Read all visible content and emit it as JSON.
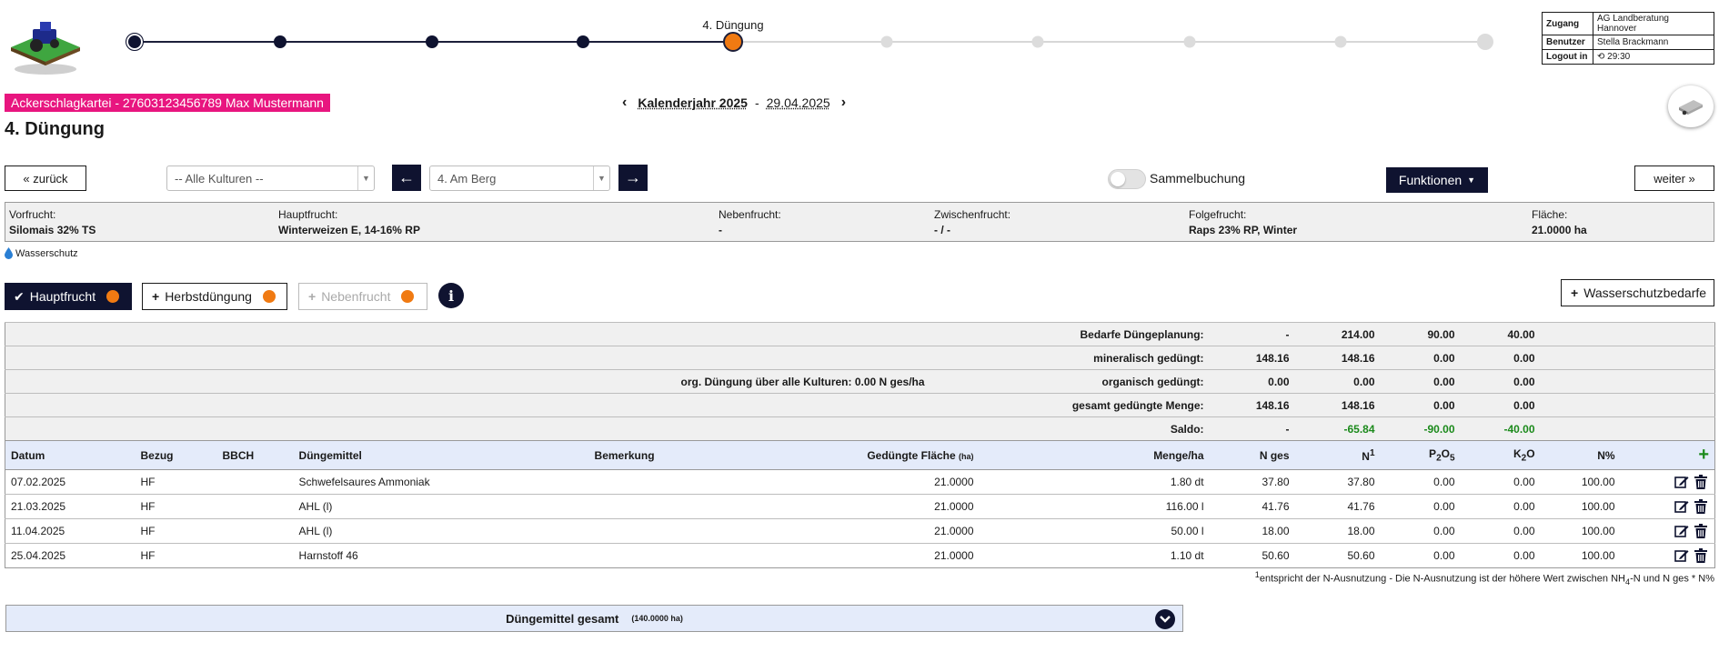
{
  "stepper": {
    "current_label": "4. Düngung",
    "total_steps": 11,
    "current_step": 5
  },
  "user": {
    "zugang_label": "Zugang",
    "zugang_value": "AG Landberatung Hannover",
    "benutzer_label": "Benutzer",
    "benutzer_value": "Stella Brackmann",
    "logout_label": "Logout in",
    "logout_value": "29:30"
  },
  "header": {
    "record": "Ackerschlagkartei - 27603123456789 Max Mustermann",
    "year": "Kalenderjahr 2025",
    "separator": "-",
    "date": "29.04.2025",
    "title": "4. Düngung"
  },
  "toolbar": {
    "back": "« zurück",
    "kulturen": "-- Alle Kulturen --",
    "field": "4. Am Berg",
    "sammelbuchung": "Sammelbuchung",
    "funktionen": "Funktionen",
    "next": "weiter »"
  },
  "crop": {
    "vorfrucht_label": "Vorfrucht:",
    "vorfrucht": "Silomais 32% TS",
    "hauptfrucht_label": "Hauptfrucht:",
    "hauptfrucht": "Winterweizen E, 14-16% RP",
    "nebenfrucht_label": "Nebenfrucht:",
    "nebenfrucht": "-",
    "zwischenfrucht_label": "Zwischenfrucht:",
    "zwischenfrucht": "- / -",
    "folgefrucht_label": "Folgefrucht:",
    "folgefrucht": "Raps 23% RP, Winter",
    "flaeche_label": "Fläche:",
    "flaeche": "21.0000 ha"
  },
  "wasserschutz": "Wasserschutz",
  "tabs": {
    "hauptfrucht": "Hauptfrucht",
    "herbst": "Herbstdüngung",
    "neben": "Nebenfrucht",
    "wasserschutzbedarfe": "Wasserschutzbedarfe"
  },
  "summary": [
    {
      "note": "",
      "label": "Bedarfe Düngeplanung:",
      "v": [
        "-",
        "214.00",
        "90.00",
        "40.00"
      ],
      "green": false
    },
    {
      "note": "",
      "label": "mineralisch gedüngt:",
      "v": [
        "148.16",
        "148.16",
        "0.00",
        "0.00"
      ],
      "green": false
    },
    {
      "note": "org. Düngung über alle Kulturen: 0.00 N ges/ha",
      "label": "organisch gedüngt:",
      "v": [
        "0.00",
        "0.00",
        "0.00",
        "0.00"
      ],
      "green": false
    },
    {
      "note": "",
      "label": "gesamt gedüngte Menge:",
      "v": [
        "148.16",
        "148.16",
        "0.00",
        "0.00"
      ],
      "green": false
    },
    {
      "note": "",
      "label": "Saldo:",
      "v": [
        "-",
        "-65.84",
        "-90.00",
        "-40.00"
      ],
      "green": true
    }
  ],
  "columns": {
    "datum": "Datum",
    "bezug": "Bezug",
    "bbch": "BBCH",
    "duengemittel": "Düngemittel",
    "bemerkung": "Bemerkung",
    "flaeche": "Gedüngte Fläche",
    "flaeche_unit": "(ha)",
    "menge": "Menge/ha",
    "nges": "N ges",
    "n1": "N",
    "n1_sup": "1",
    "p2o5_a": "P",
    "p2o5_s1": "2",
    "p2o5_b": "O",
    "p2o5_s2": "5",
    "k2o_a": "K",
    "k2o_s": "2",
    "k2o_b": "O",
    "npct": "N%"
  },
  "rows": [
    {
      "datum": "07.02.2025",
      "bezug": "HF",
      "bbch": "",
      "duengemittel": "Schwefelsaures Ammoniak",
      "bemerkung": "",
      "flaeche": "21.0000",
      "menge": "1.80 dt",
      "nges": "37.80",
      "n1": "37.80",
      "p2o5": "0.00",
      "k2o": "0.00",
      "npct": "100.00"
    },
    {
      "datum": "21.03.2025",
      "bezug": "HF",
      "bbch": "",
      "duengemittel": "AHL (l)",
      "bemerkung": "",
      "flaeche": "21.0000",
      "menge": "116.00 l",
      "nges": "41.76",
      "n1": "41.76",
      "p2o5": "0.00",
      "k2o": "0.00",
      "npct": "100.00"
    },
    {
      "datum": "11.04.2025",
      "bezug": "HF",
      "bbch": "",
      "duengemittel": "AHL (l)",
      "bemerkung": "",
      "flaeche": "21.0000",
      "menge": "50.00 l",
      "nges": "18.00",
      "n1": "18.00",
      "p2o5": "0.00",
      "k2o": "0.00",
      "npct": "100.00"
    },
    {
      "datum": "25.04.2025",
      "bezug": "HF",
      "bbch": "",
      "duengemittel": "Harnstoff 46",
      "bemerkung": "",
      "flaeche": "21.0000",
      "menge": "1.10 dt",
      "nges": "50.60",
      "n1": "50.60",
      "p2o5": "0.00",
      "k2o": "0.00",
      "npct": "100.00"
    }
  ],
  "footnote": {
    "sup": "1",
    "text_a": "entspricht der N-Ausnutzung - Die N-Ausnutzung ist der höhere Wert zwischen NH",
    "sub": "4",
    "text_b": "-N und N ges * N%"
  },
  "total": {
    "label": "Düngemittel gesamt",
    "area": "(140.0000 ha)"
  },
  "colors": {
    "navy": "#0f1330",
    "pink": "#e8157f",
    "orange": "#f07a12",
    "green": "#1b8a1b"
  }
}
